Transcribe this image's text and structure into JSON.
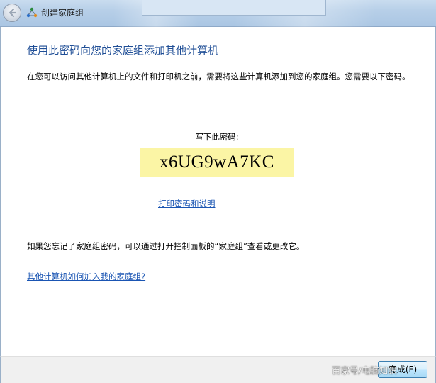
{
  "window": {
    "title": "创建家庭组",
    "back_icon": "back-arrow-icon",
    "app_icon": "homegroup-icon"
  },
  "main": {
    "heading": "使用此密码向您的家庭组添加其他计算机",
    "intro": "在您可以访问其他计算机上的文件和打印机之前，需要将这些计算机添加到您的家庭组。您需要以下密码。",
    "password_label": "写下此密码:",
    "password": "x6UG9wA7KC",
    "print_link": "打印密码和说明",
    "forgot_text": "如果您忘记了家庭组密码，可以通过打开控制面板的“家庭组”查看或更改它。",
    "join_link": "其他计算机如何加入我的家庭组?"
  },
  "footer": {
    "finish_label": "完成(F)"
  },
  "watermark": "百家号/电脑知识"
}
